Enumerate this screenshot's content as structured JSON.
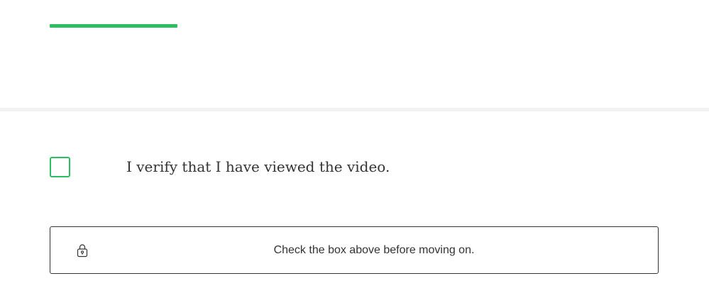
{
  "colors": {
    "accent": "#2dbe60",
    "text": "#333333",
    "divider": "#f2f2f2",
    "border": "#333333"
  },
  "verification": {
    "checkbox_checked": false,
    "label": "I verify that I have viewed the video."
  },
  "gate": {
    "icon": "lock-icon",
    "message": "Check the box above before moving on."
  }
}
